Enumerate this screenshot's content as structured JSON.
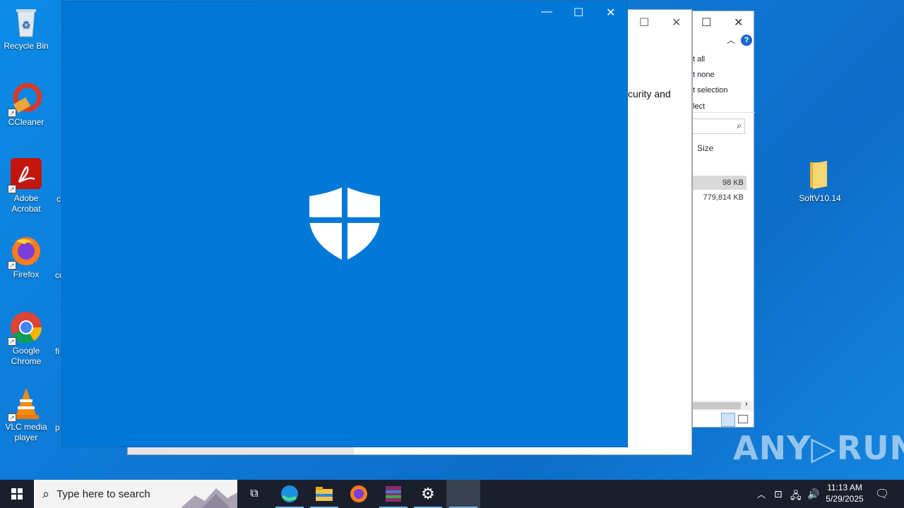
{
  "desktop": {
    "icons": [
      {
        "label": "Recycle Bin"
      },
      {
        "label": "CCleaner"
      },
      {
        "label": "Adobe Acrobat"
      },
      {
        "label": "Firefox"
      },
      {
        "label": "Google Chrome"
      },
      {
        "label": "VLC media player"
      },
      {
        "label": "SoftV10.14"
      }
    ],
    "partial_labels": [
      "c",
      "cc",
      "fi",
      "p"
    ]
  },
  "explorer": {
    "ribbon": [
      "t all",
      "t none",
      "t selection",
      "lect"
    ],
    "column_size": "Size",
    "rows": [
      "98 KB",
      "779,814 KB"
    ],
    "help_glyph": "?"
  },
  "dialog": {
    "text": "curity and"
  },
  "security_window": {
    "minimize_glyph": "—",
    "maximize_glyph": "☐",
    "close_glyph": "✕"
  },
  "watermark": "ANY▷RUN",
  "taskbar": {
    "search_placeholder": "Type here to search",
    "time": "11:13 AM",
    "date": "5/29/2025"
  },
  "colors": {
    "accent": "#0078d7",
    "taskbar": "#1a1f2b"
  }
}
